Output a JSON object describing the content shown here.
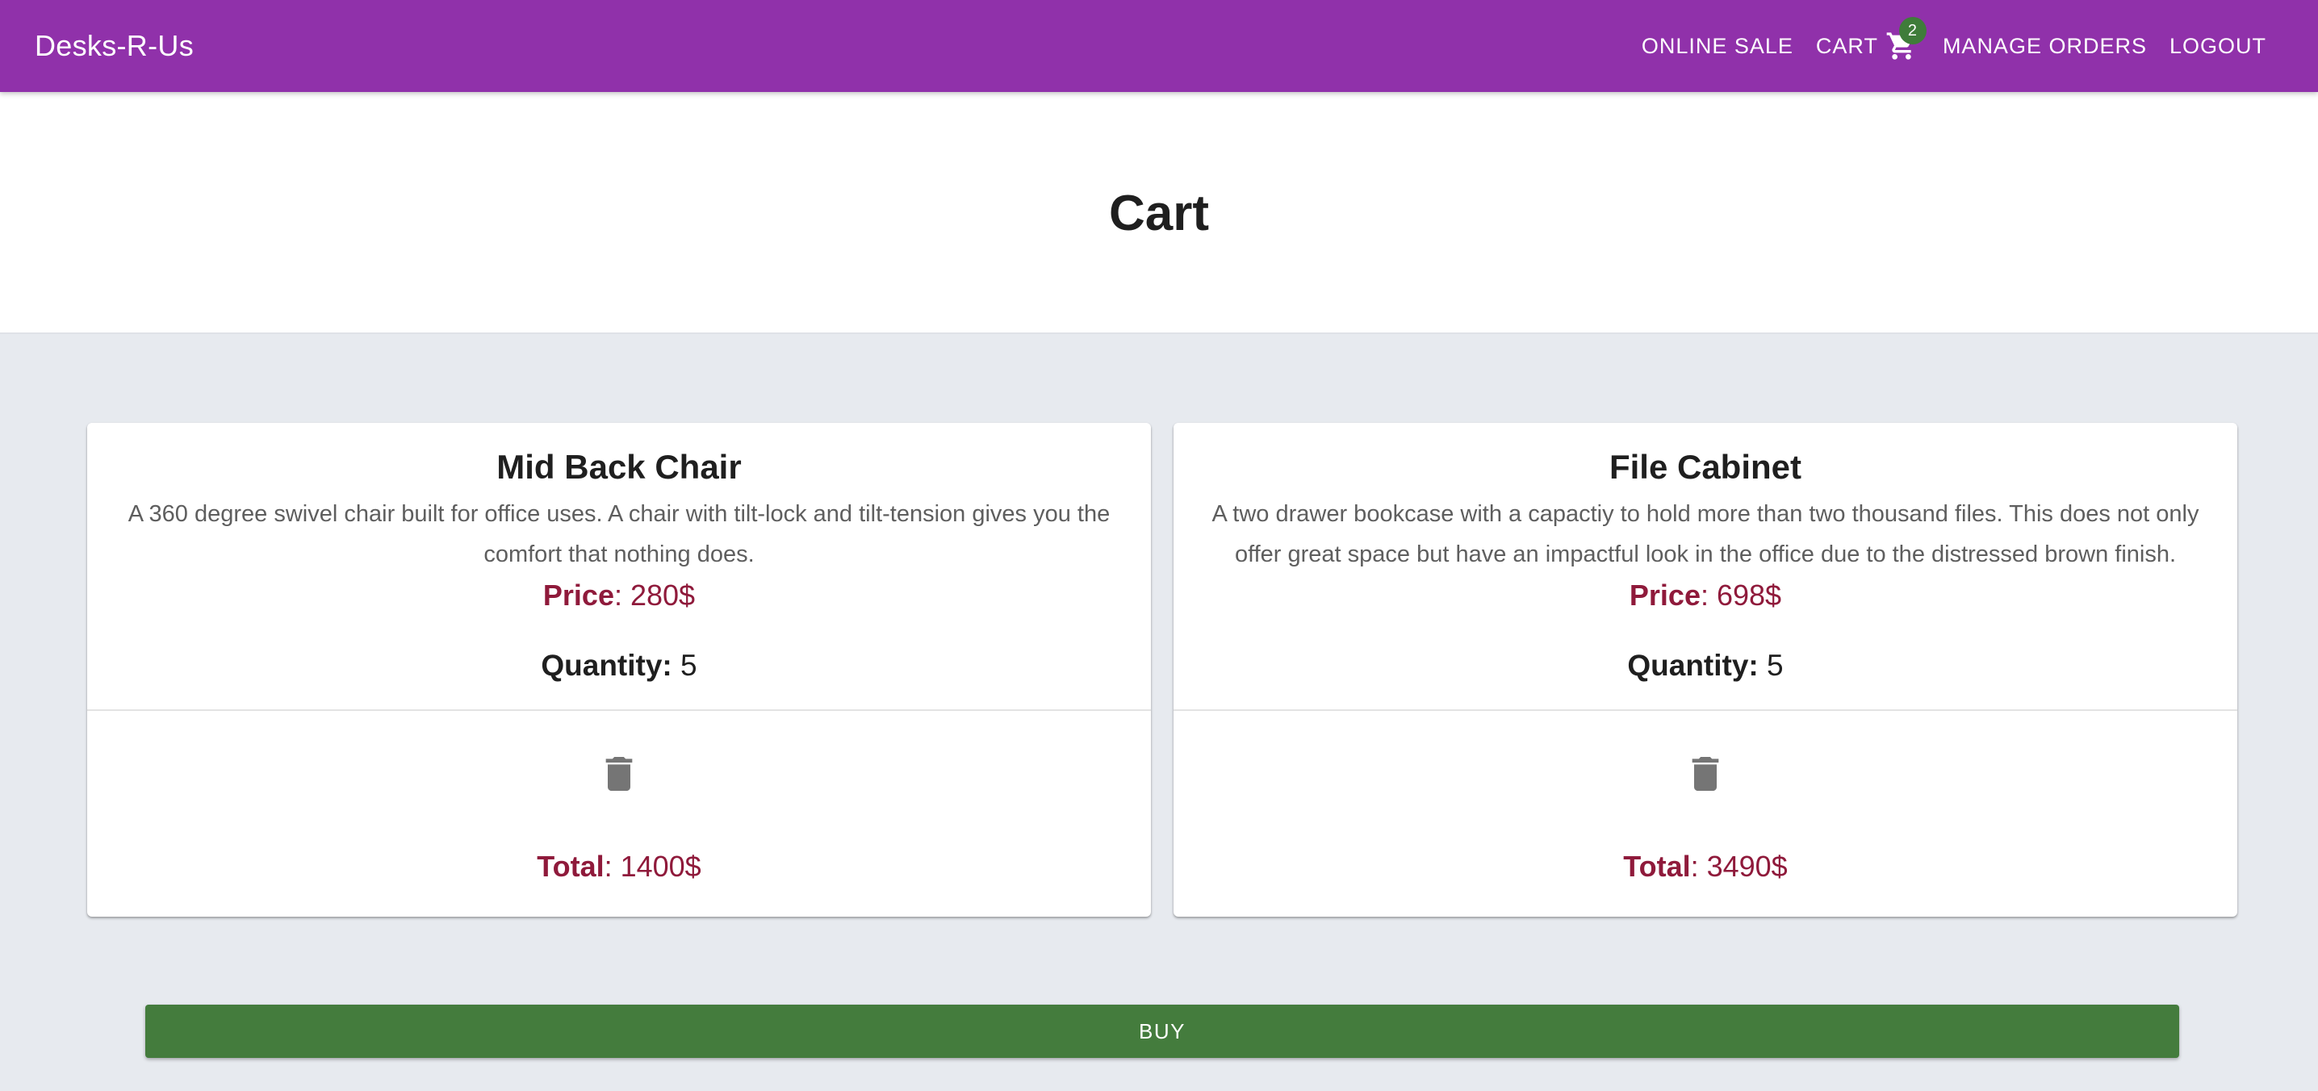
{
  "header": {
    "brand": "Desks-R-Us",
    "nav": {
      "online_sale": "ONLINE SALE",
      "cart": "CART",
      "cart_count": "2",
      "manage_orders": "MANAGE ORDERS",
      "logout": "LOGOUT"
    }
  },
  "page": {
    "title": "Cart"
  },
  "cart_items": [
    {
      "name": "Mid Back Chair",
      "description": "A 360 degree swivel chair built for office uses. A chair with tilt-lock and tilt-tension gives you the comfort that nothing does.",
      "price_label": "Price",
      "price_value": ": 280$",
      "quantity_label": "Quantity:",
      "quantity_value": " 5",
      "total_label": "Total",
      "total_value": ": 1400$"
    },
    {
      "name": "File Cabinet",
      "description": "A two drawer bookcase with a capactiy to hold more than two thousand files. This does not only offer great space but have an impactful look in the office due to the distressed brown finish.",
      "price_label": "Price",
      "price_value": ": 698$",
      "quantity_label": "Quantity:",
      "quantity_value": " 5",
      "total_label": "Total",
      "total_value": ": 3490$"
    }
  ],
  "actions": {
    "buy_label": "BUY"
  },
  "icons": {
    "cart": "shopping-cart-icon",
    "delete": "trash-icon"
  },
  "colors": {
    "app_bar": "#9031aa",
    "buy_button": "#447c3d",
    "badge": "#3f7c3a",
    "price_accent": "#8f1a3b",
    "background": "#e7eaef"
  }
}
